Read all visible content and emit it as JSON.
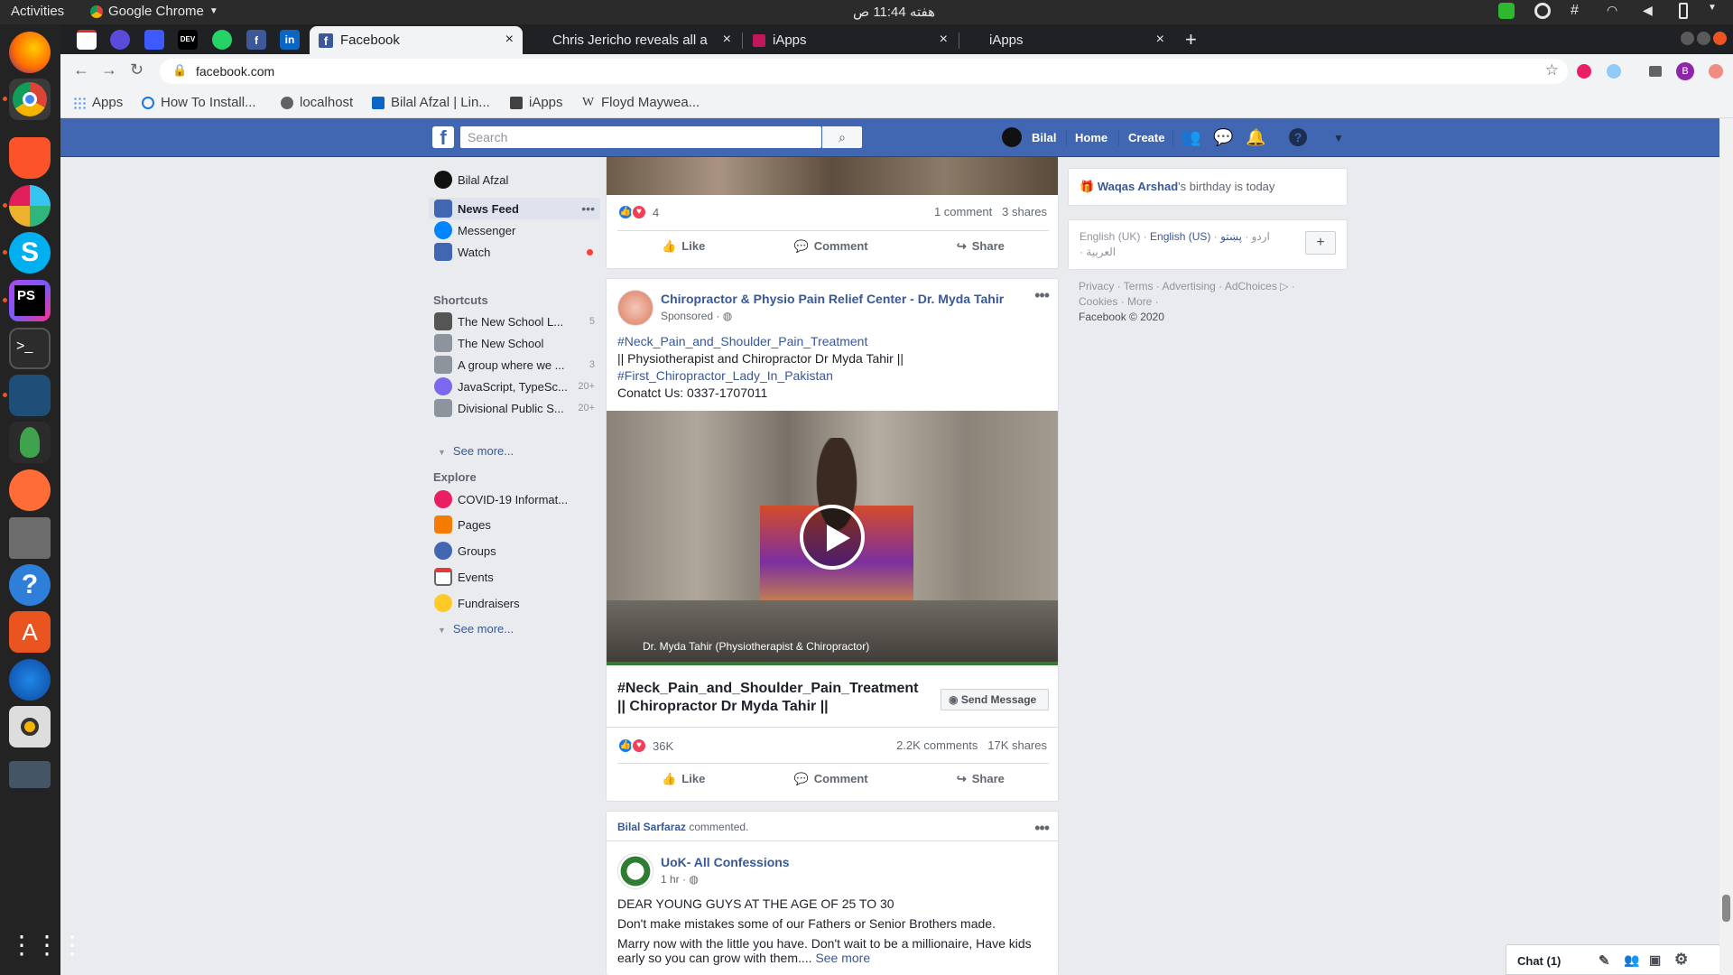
{
  "os": {
    "activities": "Activities",
    "app_name": "Google Chrome",
    "clock": "هفته 11:44 ص"
  },
  "browser": {
    "tabs": [
      {
        "title": "Facebook",
        "active": true
      },
      {
        "title": "Chris Jericho reveals all a",
        "active": false
      },
      {
        "title": "iApps",
        "active": false
      },
      {
        "title": "iApps",
        "active": false
      }
    ],
    "url": "facebook.com",
    "profile_initial": "B",
    "bookmarks": [
      {
        "label": "Apps",
        "icon": "apps-grid-icon"
      },
      {
        "label": "How To Install...",
        "icon": "howto-icon"
      },
      {
        "label": "localhost",
        "icon": "globe-icon"
      },
      {
        "label": "Bilal Afzal | Lin...",
        "icon": "linkedin-icon"
      },
      {
        "label": "iApps",
        "icon": "iapps-icon"
      },
      {
        "label": "Floyd Maywea...",
        "icon": "wikipedia-icon"
      }
    ]
  },
  "fb_header": {
    "search_placeholder": "Search",
    "user": "Bilal",
    "home": "Home",
    "create": "Create"
  },
  "left_nav": {
    "profile": "Bilal Afzal",
    "main": [
      {
        "label": "News Feed"
      },
      {
        "label": "Messenger"
      },
      {
        "label": "Watch"
      }
    ],
    "shortcuts_title": "Shortcuts",
    "shortcuts": [
      {
        "label": "The New School L...",
        "count": "5"
      },
      {
        "label": "The New School",
        "count": ""
      },
      {
        "label": "A group where we ...",
        "count": "3"
      },
      {
        "label": "JavaScript, TypeSc...",
        "count": "20+"
      },
      {
        "label": "Divisional Public S...",
        "count": "20+"
      }
    ],
    "see_more": "See more...",
    "explore_title": "Explore",
    "explore": [
      {
        "label": "COVID-19 Informat..."
      },
      {
        "label": "Pages"
      },
      {
        "label": "Groups"
      },
      {
        "label": "Events"
      },
      {
        "label": "Fundraisers"
      }
    ]
  },
  "feed": {
    "post1": {
      "reactions_count": "4",
      "comments": "1 comment",
      "shares": "3 shares"
    },
    "actions": {
      "like": "Like",
      "comment": "Comment",
      "share": "Share"
    },
    "post2": {
      "page_name": "Chiropractor & Physio Pain Relief Center - Dr. Myda Tahir",
      "meta": "Sponsored · ",
      "line1": "#Neck_Pain_and_Shoulder_Pain_Treatment",
      "line2": "|| Physiotherapist and Chiropractor Dr Myda Tahir ||",
      "line3": "#First_Chiropractor_Lady_In_Pakistan",
      "line4": "Conatct Us: 0337-1707011",
      "video_caption": "Dr. Myda Tahir (Physiotherapist & Chiropractor)",
      "headline1": "#Neck_Pain_and_Shoulder_Pain_Treatment",
      "headline2": "|| Chiropractor Dr Myda Tahir ||",
      "send_message": "Send Message",
      "reactions_count": "36K",
      "comments": "2.2K comments",
      "shares": "17K shares"
    },
    "post3": {
      "commenter": "Bilal Sarfaraz",
      "commented": " commented.",
      "page_name": "UoK- All Confessions",
      "time": "1 hr · ",
      "line1": "DEAR YOUNG GUYS AT THE AGE OF 25 TO 30",
      "line2": "Don't make mistakes some of our Fathers or Senior Brothers made.",
      "line3": "Marry now with the little you have. Don't wait to be a millionaire, Have kids",
      "line4": "early so you can grow with them....",
      "see_more": "See more"
    }
  },
  "right_col": {
    "birthday_name": "Waqas Arshad",
    "birthday_text": "'s birthday is today",
    "lang_uk": "English (UK)",
    "lang_us": "English (US)",
    "lang_urdu": "اردو",
    "lang_pashto": "پښتو",
    "lang_arabic": "العربية",
    "footer_line1": "Privacy · Terms · Advertising · AdChoices",
    "footer_line2": "Cookies · More ·",
    "copyright": "Facebook © 2020"
  },
  "chat": {
    "label": "Chat (1)"
  },
  "colors": {
    "fb_blue": "#4267b2",
    "link": "#385898",
    "chrome_dark": "#202124"
  }
}
